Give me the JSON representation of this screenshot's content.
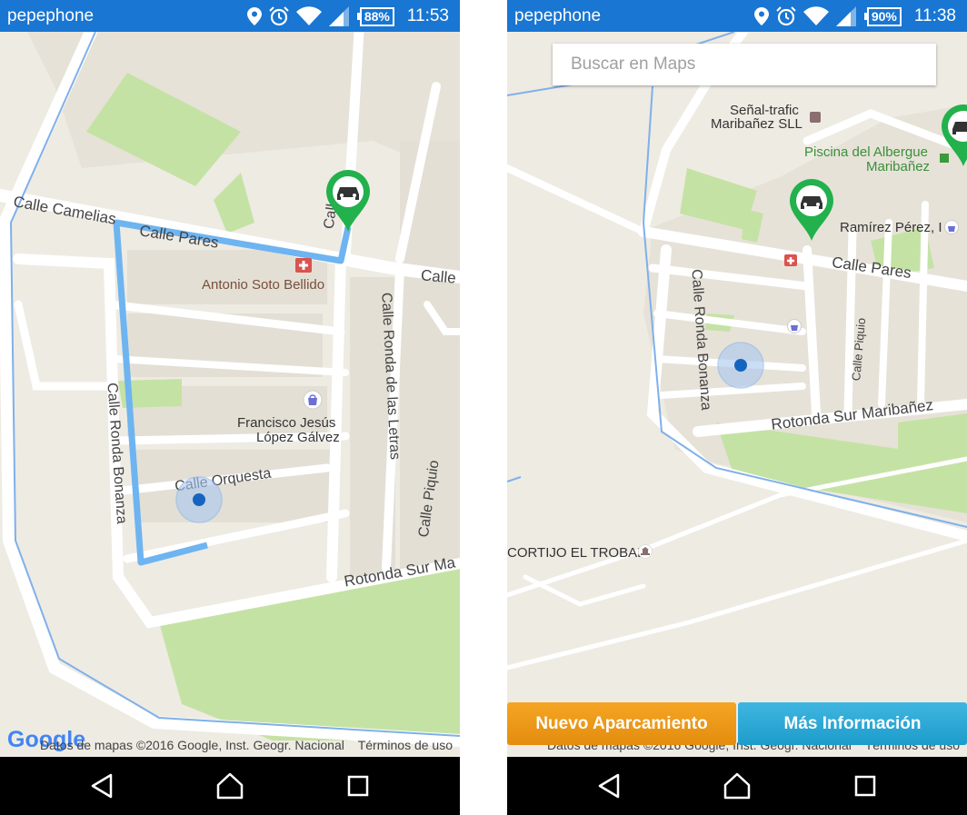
{
  "status_left": {
    "carrier": "pepephone",
    "battery": "88%",
    "time": "11:53"
  },
  "status_right": {
    "carrier": "pepephone",
    "battery": "90%",
    "time": "11:38"
  },
  "left_map": {
    "streets": {
      "camelias": "Calle Camelias",
      "pares": "Calle Pares",
      "ramirez_partial": "Calle R",
      "calle_partial": "Calle",
      "ronda_letras": "Calle Ronda de las Letras",
      "ronda_bonanza": "Calle Ronda Bonanza",
      "orquesta": "Calle Orquesta",
      "piquio": "Calle Piquio",
      "rotonda": "Rotonda Sur Ma"
    },
    "pois": {
      "pharmacy": "Antonio Soto Bellido",
      "shop_line1": "Francisco Jesús",
      "shop_line2": "López Gálvez"
    },
    "google_logo": "Google",
    "attribution": "Datos de mapas ©2016 Google, Inst. Geogr. Nacional",
    "terms": "Términos de uso"
  },
  "right_map": {
    "search_placeholder": "Buscar en Maps",
    "streets": {
      "pares": "Calle Pares",
      "ronda_bonanza": "Calle Ronda Bonanza",
      "piquio": "Calle Piquio",
      "rotonda": "Rotonda Sur Maribañez"
    },
    "pois": {
      "senal_line1": "Señal-trafic",
      "senal_line2": "Maribañez SLL",
      "piscina_line1": "Piscina del Albergue",
      "piscina_line2": "Maribañez",
      "ramirez": "Ramírez Pérez, I",
      "cortijo": "CORTIJO EL TROBAL"
    },
    "attribution": "Datos de mapas ©2016 Google, Inst. Geogr. Nacional",
    "terms": "Términos de uso",
    "buttons": {
      "nuevo": "Nuevo Aparcamiento",
      "info": "Más Información"
    }
  },
  "colors": {
    "status_bar": "#1976d2",
    "pin_green": "#22b14c",
    "route": "#6eb4f0",
    "park": "#c5e2a5",
    "btn_orange": "#f0a020",
    "btn_blue": "#35b0de"
  },
  "icons": [
    "location-icon",
    "alarm-icon",
    "wifi-icon",
    "signal-icon",
    "battery-icon",
    "car-pin-icon",
    "pharmacy-icon",
    "shopping-icon",
    "back-nav-icon",
    "home-nav-icon",
    "recents-nav-icon",
    "my-location-dot-icon"
  ]
}
